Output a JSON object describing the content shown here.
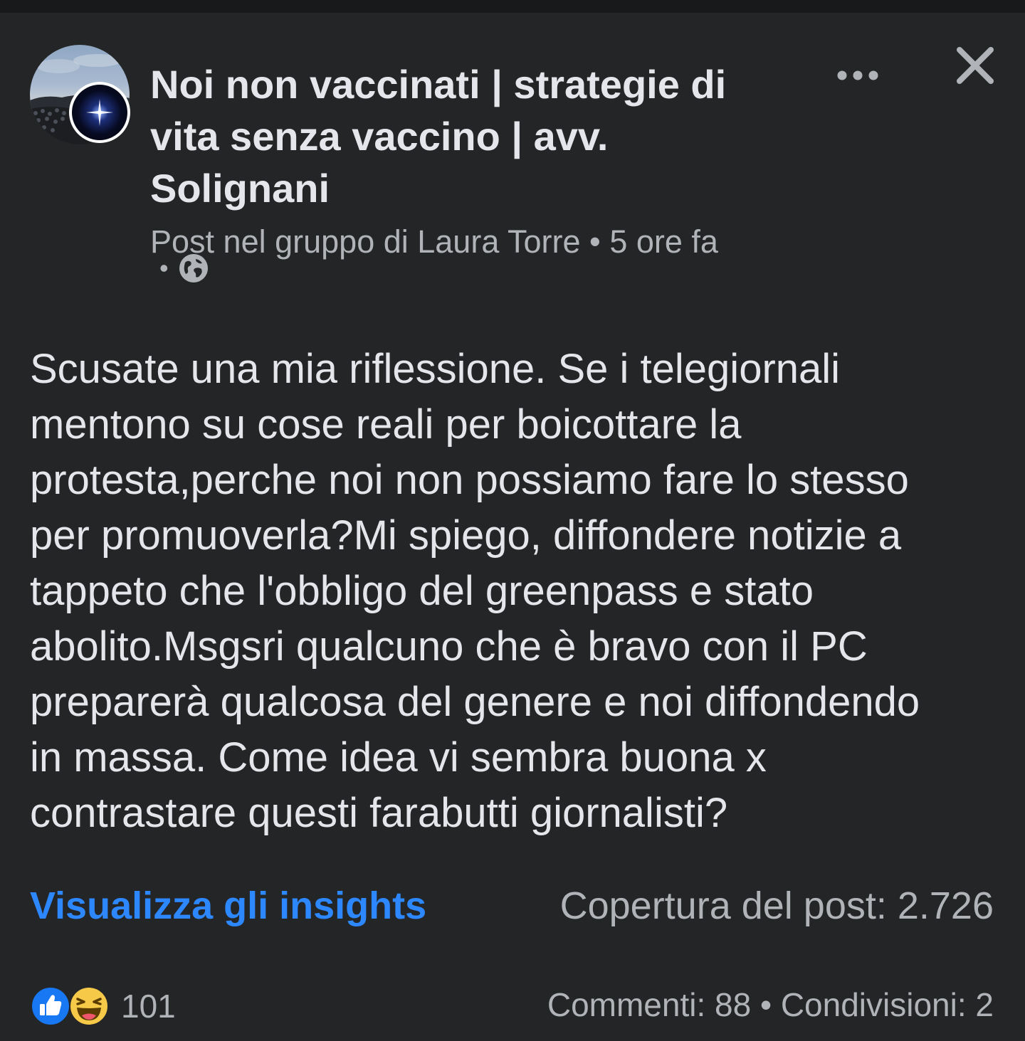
{
  "post": {
    "group_name_lines": [
      "Noi non vaccinati | strategie di",
      "vita senza vaccino | avv.",
      "Solignani"
    ],
    "meta": "Post nel gruppo di Laura Torre • 5 ore fa",
    "meta_line2": "•",
    "privacy_icon": "globe-icon",
    "text_lines": [
      "Scusate una mia riflessione. Se i telegiornali",
      "mentono su cose reali per boicottare la",
      "protesta,perche noi non possiamo fare lo stesso",
      "per promuoverla?Mi spiego, diffondere notizie a",
      "tappeto  che l'obbligo del greenpass e stato",
      "abolito.Msgsri qualcuno che è  bravo con il PC",
      "preparerà qualcosa del genere e noi diffondendo",
      "in massa. Come idea vi sembra buona x",
      "contrastare questi farabutti giornalisti?"
    ],
    "insights_label": "Visualizza gli insights",
    "reach": "Copertura del post: 2.726",
    "reactions_count": "101",
    "reaction_icons": [
      "like-icon",
      "haha-icon"
    ],
    "stats": "Commenti: 88 • Condivisioni: 2"
  },
  "header_icons": [
    "more-options-icon",
    "close-icon"
  ],
  "colors": {
    "background": "#18191a",
    "card": "#242526",
    "primary_text": "#e4e6eb",
    "secondary_text": "#b0b3b8",
    "link": "#2d88ff"
  }
}
